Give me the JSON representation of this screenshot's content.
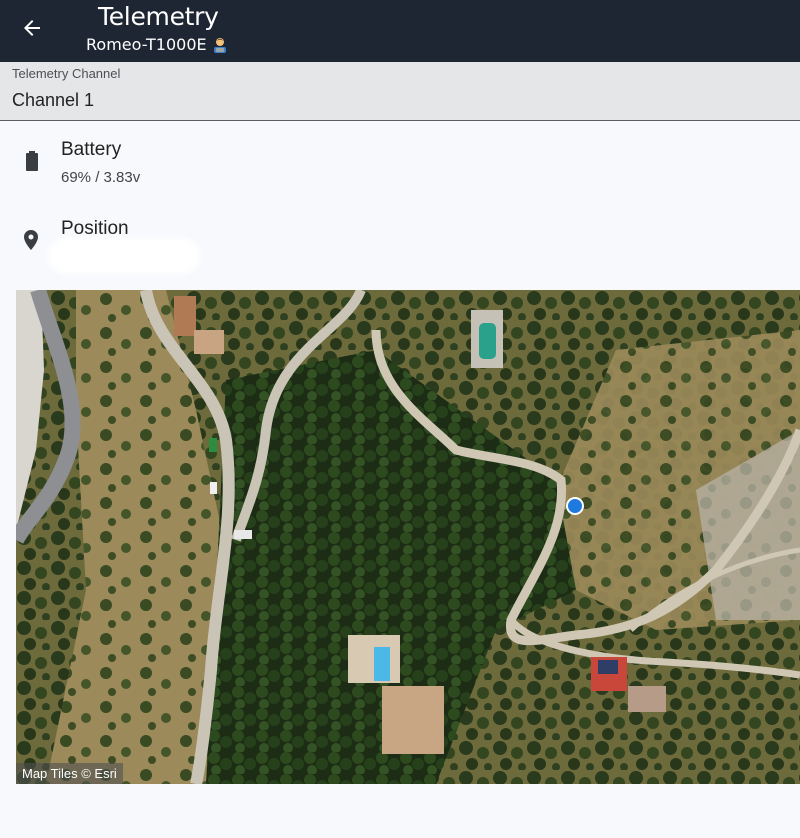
{
  "appbar": {
    "title": "Telemetry",
    "subtitle": "Romeo-T1000E",
    "emoji_icon": "person-technologist-emoji",
    "back_icon": "arrow-left-icon"
  },
  "channel_select": {
    "label": "Telemetry Channel",
    "value": "Channel 1"
  },
  "battery": {
    "icon": "battery-icon",
    "title": "Battery",
    "value": "69% / 3.83v"
  },
  "position": {
    "icon": "location-pin-icon",
    "title": "Position"
  },
  "map": {
    "attribution": "Map Tiles © Esri",
    "marker_color": "#1f7ae0"
  },
  "colors": {
    "appbar_bg": "#1e2533",
    "page_bg": "#f7f9fc",
    "select_bg": "#e5e6e8"
  }
}
